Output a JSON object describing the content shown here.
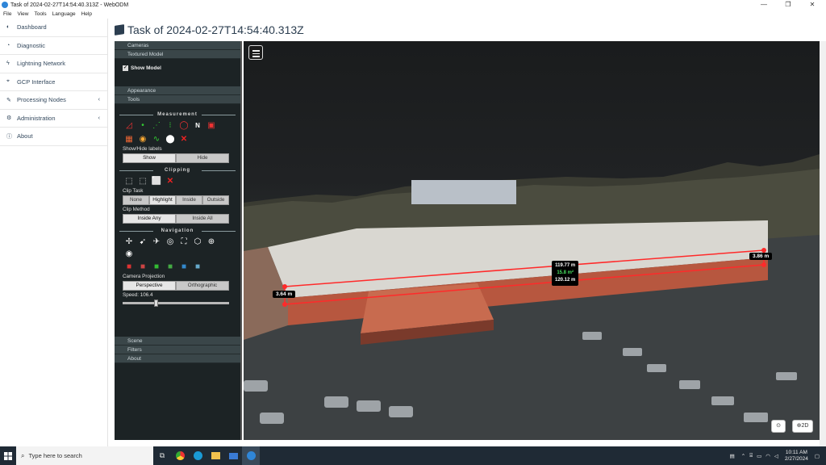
{
  "window": {
    "title": "Task of 2024-02-27T14:54:40.313Z - WebODM",
    "controls": [
      "—",
      "❐",
      "✕"
    ]
  },
  "menubar": [
    "File",
    "View",
    "Tools",
    "Language",
    "Help"
  ],
  "sidebar": {
    "items": [
      {
        "label": "Dashboard",
        "icon": "dashboard-icon",
        "glyph": "◐",
        "chevron": false
      },
      {
        "label": "Diagnostic",
        "icon": "chart-icon",
        "glyph": "◔",
        "chevron": false
      },
      {
        "label": "Lightning Network",
        "icon": "bolt-icon",
        "glyph": "ϟ",
        "chevron": false
      },
      {
        "label": "GCP Interface",
        "icon": "marker-icon",
        "glyph": "⌖",
        "chevron": false
      },
      {
        "label": "Processing Nodes",
        "icon": "wrench-icon",
        "glyph": "✎",
        "chevron": true
      },
      {
        "label": "Administration",
        "icon": "gears-icon",
        "glyph": "⚙",
        "chevron": true
      },
      {
        "label": "About",
        "icon": "info-icon",
        "glyph": "ⓘ",
        "chevron": false
      }
    ]
  },
  "page": {
    "title": "Task of 2024-02-27T14:54:40.313Z"
  },
  "panel": {
    "top_sections": [
      "Cameras",
      "Textured Model"
    ],
    "show_model_label": "Show Model",
    "sections": [
      "Appearance",
      "Tools"
    ],
    "measurement": {
      "title": "Measurement",
      "labels_caption": "Show/Hide labels",
      "show_label": "Show",
      "hide_label": "Hide"
    },
    "clipping": {
      "title": "Clipping",
      "clip_task_caption": "Clip Task",
      "clip_task_options": [
        "None",
        "Highlight",
        "Inside",
        "Outside"
      ],
      "clip_task_selected": "Highlight",
      "clip_method_caption": "Clip Method",
      "clip_method_options": [
        "Inside Any",
        "Inside All"
      ],
      "clip_method_selected": "Inside Any"
    },
    "navigation": {
      "title": "Navigation",
      "projection_caption": "Camera Projection",
      "projection_options": [
        "Perspective",
        "Orthographic"
      ],
      "projection_selected": "Perspective",
      "speed_label": "Speed: 106.4",
      "speed_fraction": 0.3
    },
    "bottom_sections": [
      "Scene",
      "Filters",
      "About"
    ]
  },
  "viewer": {
    "measure_left": "3.64 m",
    "measure_right": "3.86 m",
    "measure_center": {
      "top": "119.77 m",
      "area": "15.8 m²",
      "bottom": "120.12 m"
    },
    "btn_2d": "2D",
    "colors": {
      "measure_line": "#ff2a2a",
      "area_text": "#48e05f"
    }
  },
  "taskbar": {
    "search_placeholder": "Type here to search",
    "time": "10:11 AM",
    "date": "2/27/2024"
  }
}
